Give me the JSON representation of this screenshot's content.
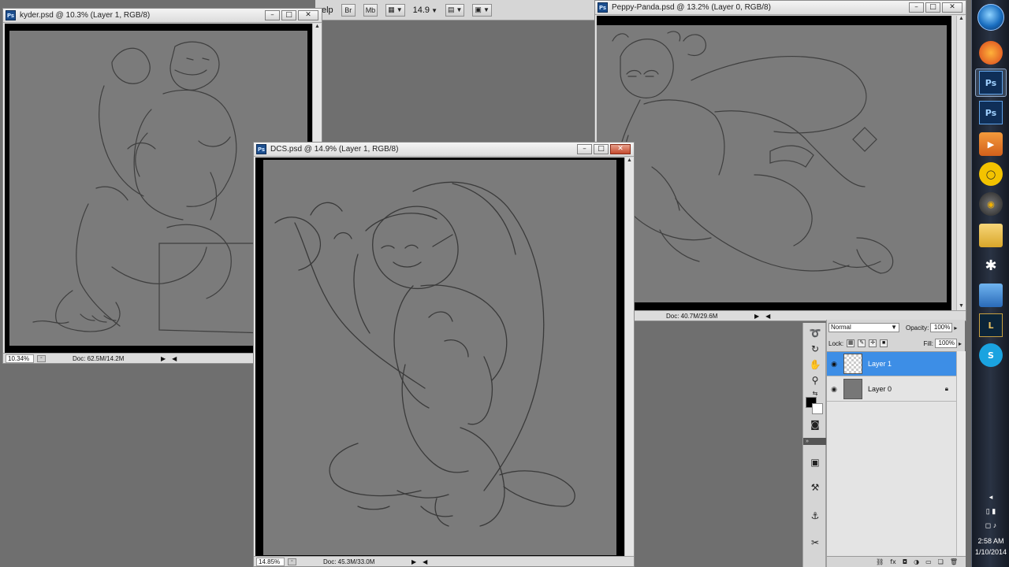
{
  "appbar": {
    "menu_fragment": "elp",
    "bridge": "Br",
    "minibridge": "Mb",
    "zoom": "14.9"
  },
  "windows": {
    "kyder": {
      "title": "kyder.psd @ 10.3% (Layer 1, RGB/8)",
      "zoom": "10.34%",
      "doc": "Doc: 62.5M/14.2M"
    },
    "peppy": {
      "title": "Peppy-Panda.psd @ 13.2% (Layer 0, RGB/8)",
      "doc": "Doc: 40.7M/29.6M"
    },
    "dcs": {
      "title": "DCS.psd @ 14.9% (Layer 1, RGB/8)",
      "zoom": "14.85%",
      "doc": "Doc: 45.3M/33.0M"
    }
  },
  "layers_panel": {
    "blend_mode": "Normal",
    "opacity_label": "Opacity:",
    "opacity": "100%",
    "lock_label": "Lock:",
    "fill_label": "Fill:",
    "fill": "100%",
    "layers": [
      {
        "name": "Layer 1",
        "selected": true,
        "visible": true,
        "locked": false
      },
      {
        "name": "Layer 0",
        "selected": false,
        "visible": true,
        "locked": true
      }
    ]
  },
  "taskbar": {
    "apps": [
      "firefox-icon",
      "photoshop-icon",
      "photoshop-icon-2",
      "media-player-icon",
      "winamp-icon",
      "speaker-app-icon",
      "file-explorer-icon",
      "zbrush-icon",
      "network-icon",
      "league-of-legends-icon",
      "skype-icon"
    ],
    "time": "2:58 AM",
    "date": "1/10/2014"
  },
  "colors": {
    "canvas_grey": "#7b7b7b",
    "selection_blue": "#3d8ee6",
    "close_red": "#c44a2e"
  }
}
